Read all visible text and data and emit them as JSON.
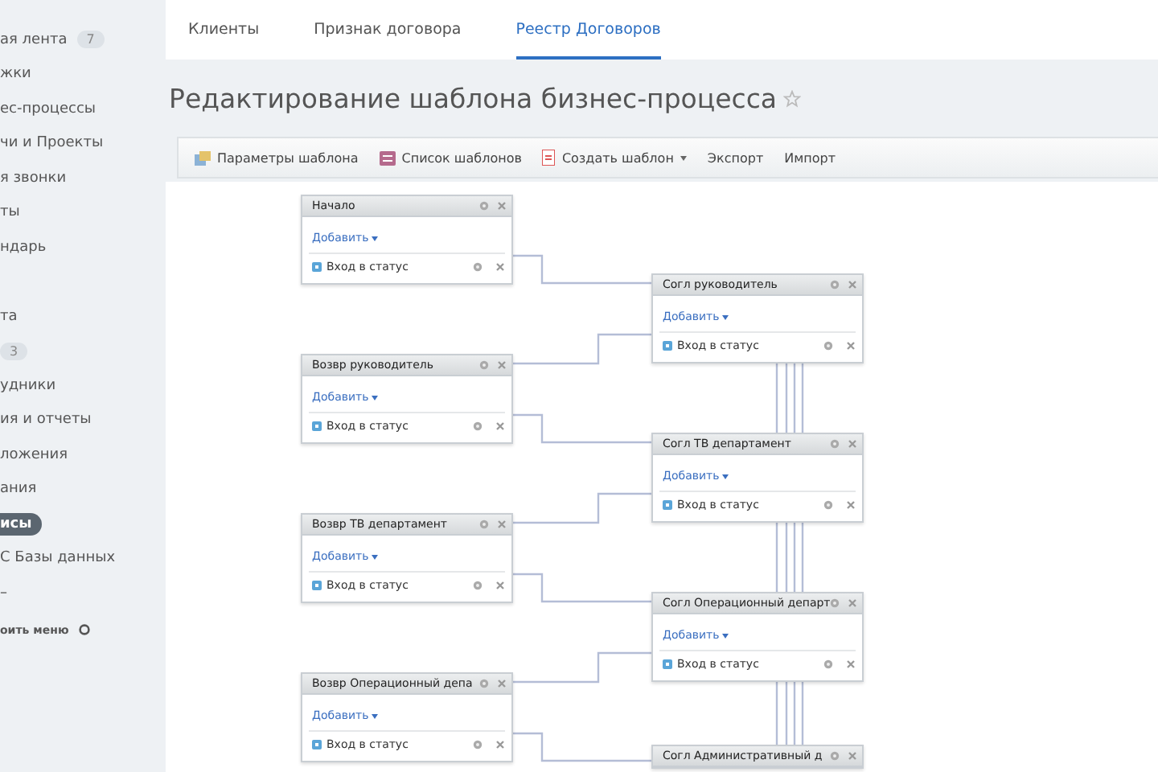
{
  "sidebar": {
    "items": [
      {
        "label": "ая лента",
        "badge": "7",
        "selected": false
      },
      {
        "label": "жки",
        "selected": false
      },
      {
        "label": "ес-процессы",
        "selected": false
      },
      {
        "label": "чи и Проекты",
        "selected": false
      },
      {
        "label": "я звонки",
        "selected": false
      },
      {
        "label": "ты",
        "selected": false
      },
      {
        "label": "ндарь",
        "selected": false
      },
      {
        "selected": false
      },
      {
        "label": "та",
        "selected": false
      },
      {
        "badge": "3",
        "selected": false
      },
      {
        "label": "удники",
        "selected": false
      },
      {
        "label": "ия и отчеты",
        "selected": false
      },
      {
        "label": "ложения",
        "selected": false
      },
      {
        "label": "ания",
        "selected": false
      },
      {
        "label": "исы",
        "selected": true
      },
      {
        "label": "С Базы данных",
        "selected": false
      },
      {
        "label": "–",
        "selected": false
      }
    ],
    "settings_label": "оить меню"
  },
  "tabs": [
    {
      "label": "Клиенты",
      "selected": false
    },
    {
      "label": "Признак договора",
      "selected": false
    },
    {
      "label": "Реестр Договоров",
      "selected": true
    }
  ],
  "page_title": "Редактирование шаблона бизнес-процесса",
  "toolbar": [
    {
      "label": "Параметры шаблона",
      "kind": "params"
    },
    {
      "label": "Список шаблонов",
      "kind": "list"
    },
    {
      "label": "Создать шаблон",
      "kind": "create",
      "dropdown": true
    },
    {
      "label": "Экспорт",
      "kind": "plain"
    },
    {
      "label": "Импорт",
      "kind": "plain"
    }
  ],
  "diagram": {
    "left_column": [
      {
        "title": "Начало",
        "add_link": "Добавить",
        "activity": "Вход в статус"
      },
      {
        "title": "Возвр руководитель",
        "add_link": "Добавить",
        "activity": "Вход в статус"
      },
      {
        "title": "Возвр ТВ департамент",
        "add_link": "Добавить",
        "activity": "Вход в статус"
      },
      {
        "title": "Возвр Операционный депа",
        "add_link": "Добавить",
        "activity": "Вход в статус"
      }
    ],
    "right_column": [
      {
        "title": "Согл руководитель",
        "add_link": "Добавить",
        "activity": "Вход в статус"
      },
      {
        "title": "Согл ТВ департамент",
        "add_link": "Добавить",
        "activity": "Вход в статус"
      },
      {
        "title": "Согл Операционный департ",
        "add_link": "Добавить",
        "activity": "Вход в статус"
      },
      {
        "title": "Согл Административный д"
      }
    ]
  }
}
